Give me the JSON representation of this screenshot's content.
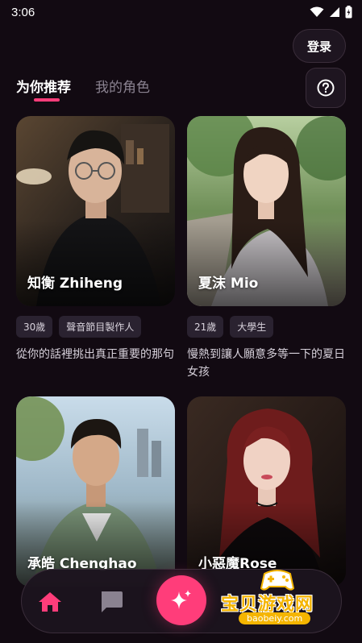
{
  "status_bar": {
    "time": "3:06"
  },
  "header": {
    "login_label": "登录"
  },
  "tabs": [
    {
      "label": "为你推荐",
      "active": true
    },
    {
      "label": "我的角色",
      "active": false
    }
  ],
  "cards": [
    {
      "name": "知衡 Zhiheng",
      "tags": [
        "30歲",
        "聲音節目製作人"
      ],
      "description": "從你的話裡挑出真正重要的那句"
    },
    {
      "name": "夏沫 Mio",
      "tags": [
        "21歲",
        "大學生"
      ],
      "description": "慢熱到讓人願意多等一下的夏日女孩"
    },
    {
      "name": "承皓 Chenghao",
      "tags": [],
      "description": ""
    },
    {
      "name": "小惡魔Rose",
      "tags": [],
      "description": ""
    }
  ],
  "bottom_nav": {
    "items": [
      {
        "icon": "home-icon",
        "active": true
      },
      {
        "icon": "chat-icon",
        "active": false
      },
      {
        "icon": "sparkle-icon",
        "active": false
      }
    ]
  },
  "watermark": {
    "text": "宝贝游戏网",
    "url": "baobeiy.com"
  },
  "colors": {
    "accent": "#ff3d7a",
    "background": "#120a12",
    "tag_bg": "#2a2230"
  }
}
